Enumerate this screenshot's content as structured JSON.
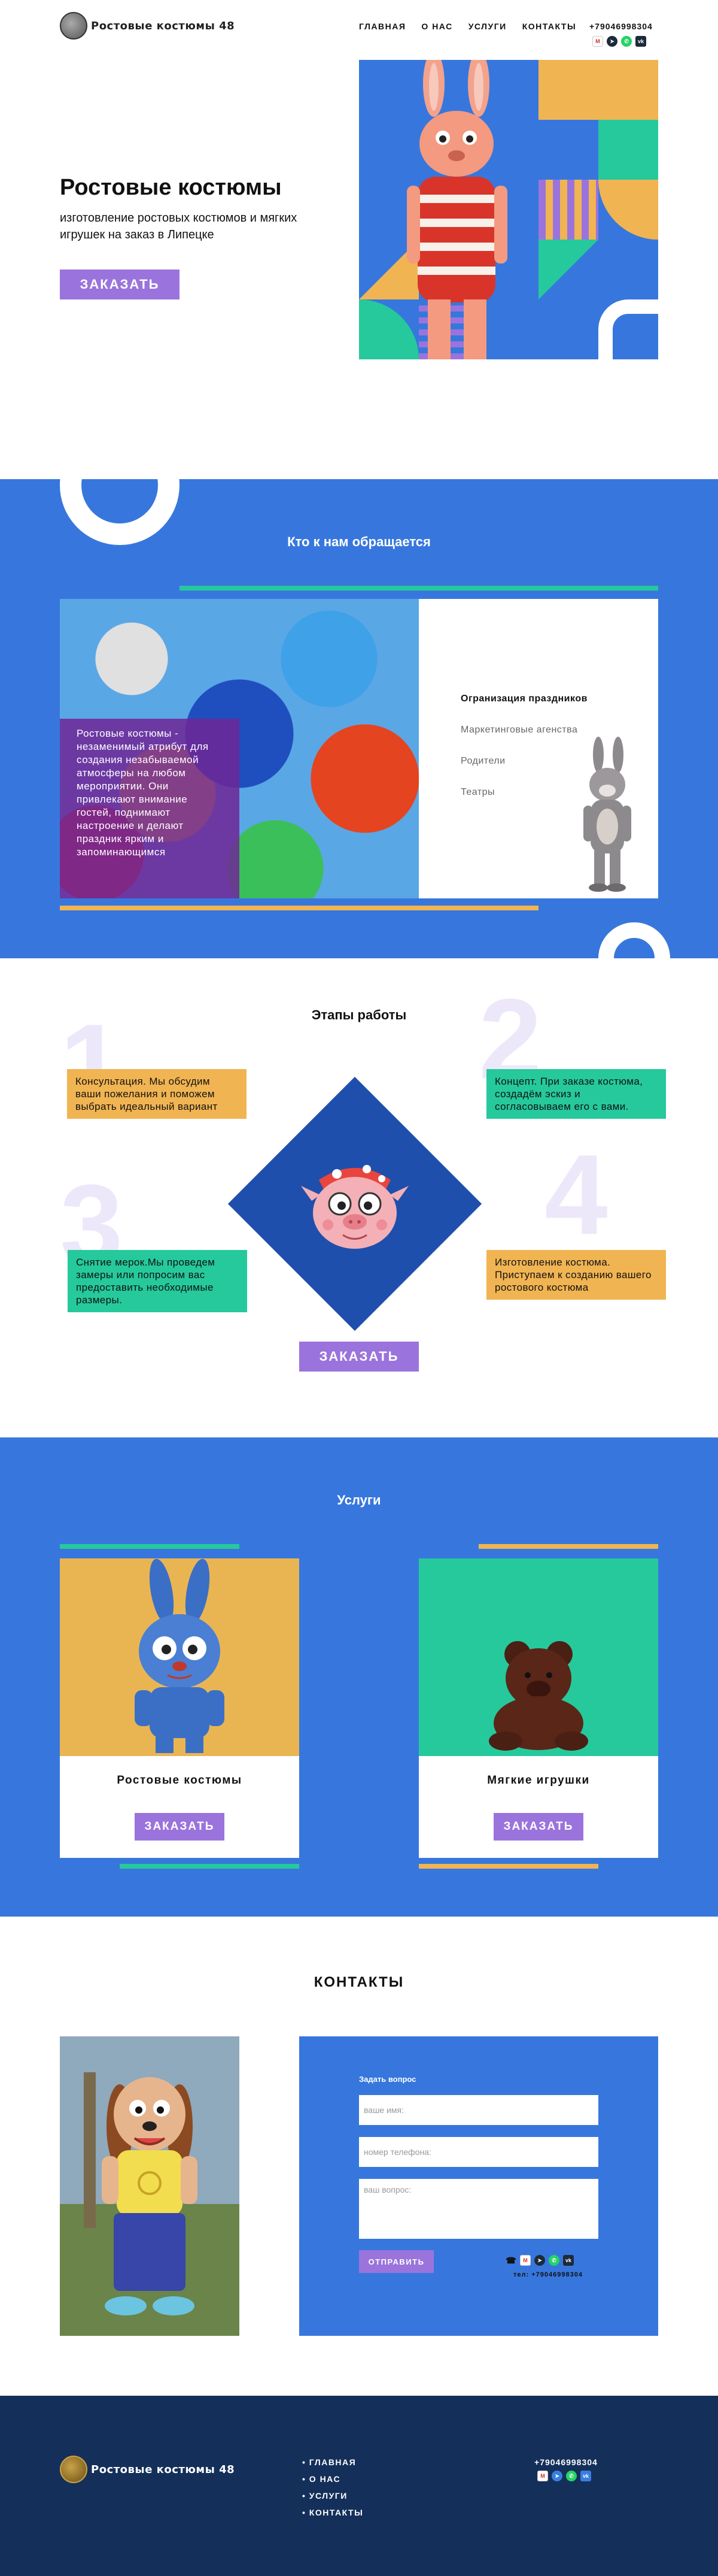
{
  "brand": {
    "logo_text": "Ростовые костюмы 48"
  },
  "nav": [
    "ГЛАВНАЯ",
    "О НАС",
    "УСЛУГИ",
    "КОНТАКТЫ"
  ],
  "phone": "+79046998304",
  "socials": [
    "gmail-icon",
    "telegram-icon",
    "whatsapp-icon",
    "vk-icon"
  ],
  "hero": {
    "title": "Ростовые костюмы",
    "subtitle": "изготовление ростовых костюмов и мягких игрушек на заказ в Липецке",
    "button": "ЗАКАЗАТЬ"
  },
  "who": {
    "title": "Кто к нам обращается",
    "overlay_text": "Ростовые костюмы - незаменимый атрибут для создания незабываемой атмосферы на любом мероприятии. Они привлекают внимание гостей, поднимают настроение и делают праздник ярким и запоминающимся",
    "items": [
      "Огранизация праздников",
      "Маркетинговые агенства",
      "Родители",
      "Театры"
    ]
  },
  "stages": {
    "title": "Этапы работы",
    "numbers": [
      "1",
      "2",
      "3",
      "4"
    ],
    "steps": [
      "Консультация. Мы обсудим ваши пожелания и поможем выбрать идеальный вариант",
      "Концепт. При заказе костюма, создадём эскиз и согласовываем его с вами.",
      "Снятие мерок.Мы проведем замеры или попросим вас предоставить необходимые размеры.",
      "Изготовление костюма. Приступаем к созданию вашего ростового костюма"
    ],
    "button": "ЗАКАЗАТЬ"
  },
  "services": {
    "title": "Услуги",
    "cards": [
      {
        "name": "Ростовые костюмы",
        "button": "ЗАКАЗАТЬ"
      },
      {
        "name": "Мягкие игрушки",
        "button": "ЗАКАЗАТЬ"
      }
    ]
  },
  "contacts": {
    "title": "КОНТАКТЫ",
    "form_title": "Задать вопрос",
    "name_placeholder": "ваше имя:",
    "phone_placeholder": "номер телефона:",
    "question_placeholder": "ваш вопрос:",
    "send_button": "ОТПРАВИТЬ",
    "phone_line": "тел: +79046998304"
  },
  "colors": {
    "primary_blue": "#3777dd",
    "accent_purple": "#9a74dc",
    "accent_orange": "#f1b452",
    "accent_teal": "#25c99c",
    "footer_navy": "#14305a"
  }
}
